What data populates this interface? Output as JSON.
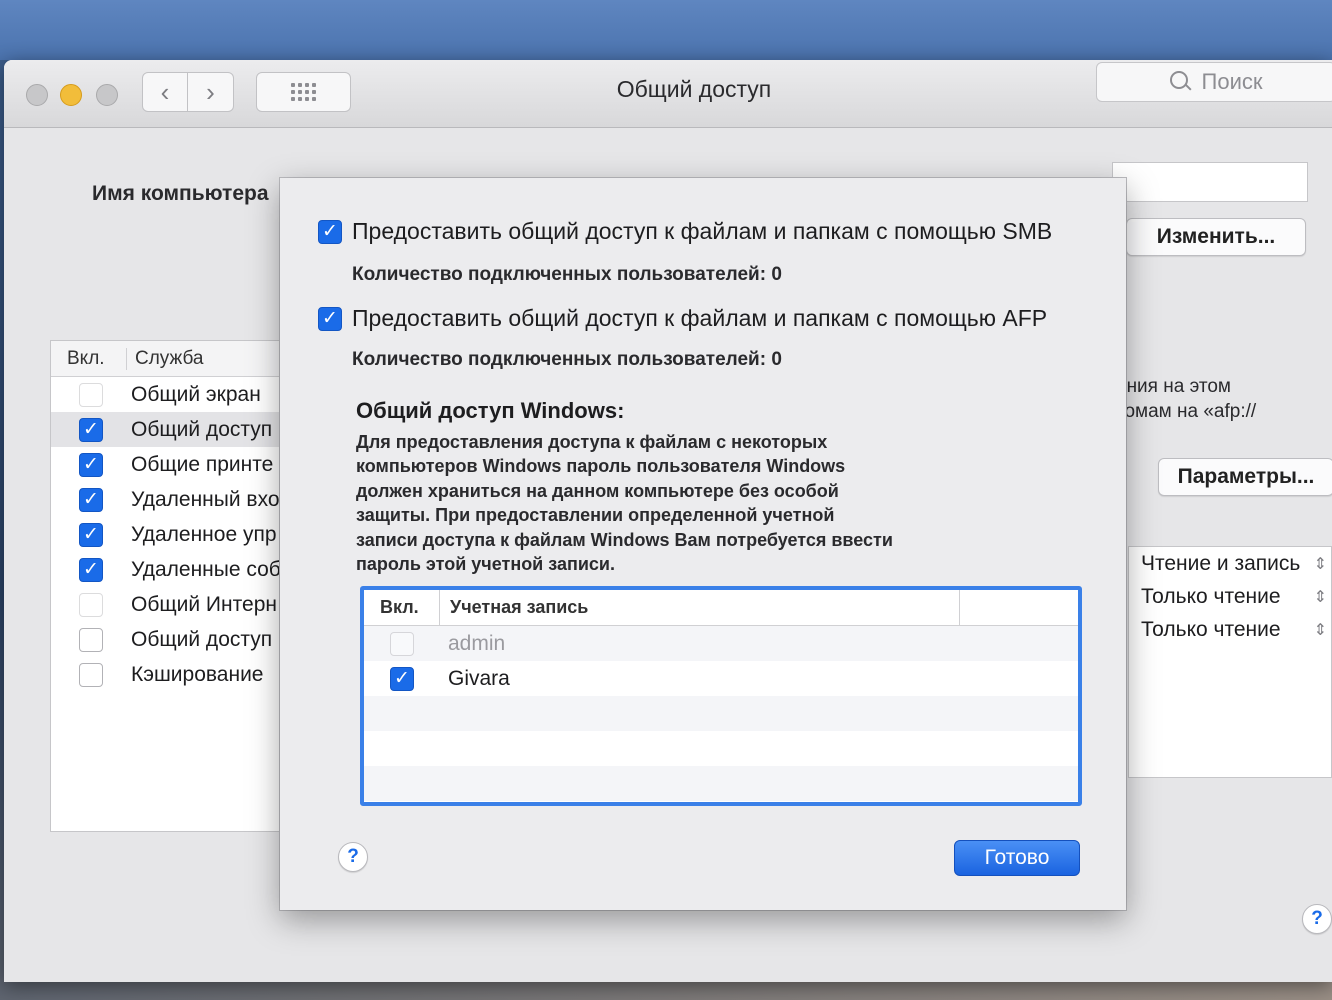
{
  "window": {
    "title": "Общий доступ",
    "search_placeholder": "Поиск"
  },
  "main": {
    "computer_name_label": "Имя компьютера",
    "edit_button": "Изменить...",
    "params_button": "Параметры...",
    "hint_line1": "ания на этом",
    "hint_line2": "томам на «afp://",
    "services_table": {
      "col_on": "Вкл.",
      "col_service": "Служба",
      "rows": [
        {
          "label": "Общий экран",
          "checked": false,
          "dim": true
        },
        {
          "label": "Общий доступ",
          "checked": true
        },
        {
          "label": "Общие принте",
          "checked": true
        },
        {
          "label": "Удаленный вхо",
          "checked": true
        },
        {
          "label": "Удаленное упр",
          "checked": true
        },
        {
          "label": "Удаленные соб",
          "checked": true
        },
        {
          "label": "Общий Интерн",
          "checked": false,
          "dim": true
        },
        {
          "label": "Общий доступ",
          "checked": false
        },
        {
          "label": "Кэширование",
          "checked": false
        }
      ]
    },
    "permissions": [
      "Чтение и запись",
      "Только чтение",
      "Только чтение"
    ]
  },
  "sheet": {
    "smb_label": "Предоставить общий доступ к файлам и папкам с помощью SMB",
    "smb_count": "Количество подключенных пользователей: 0",
    "afp_label": "Предоставить общий доступ к файлам и папкам с помощью AFP",
    "afp_count": "Количество подключенных пользователей: 0",
    "windows_heading": "Общий доступ Windows:",
    "windows_desc": [
      "Для предоставления доступа к файлам с некоторых",
      "компьютеров Windows пароль пользователя Windows",
      "должен храниться на данном компьютере без особой",
      "защиты. При предоставлении определенной учетной",
      "записи доступа к файлам Windows Вам потребуется ввести",
      "пароль этой учетной записи."
    ],
    "accounts_table": {
      "col_on": "Вкл.",
      "col_account": "Учетная запись",
      "rows": [
        {
          "name": "admin",
          "checked": false
        },
        {
          "name": "Givara",
          "checked": true
        }
      ]
    },
    "done_button": "Готово",
    "help": "?"
  },
  "colors": {
    "accent": "#1a6be8",
    "traffic_yellow": "#f2bd3a"
  }
}
